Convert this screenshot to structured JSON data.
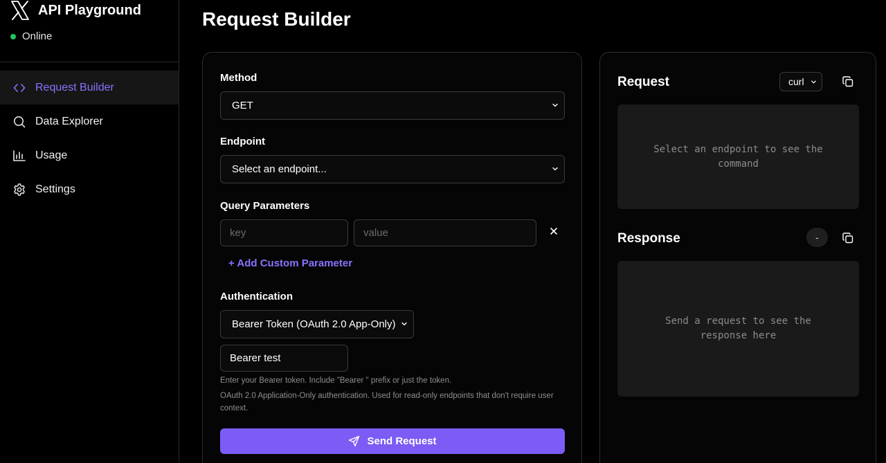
{
  "app": {
    "title": "API Playground",
    "status": "Online",
    "brand_icon": "x-logo-icon",
    "status_color": "#22c55e"
  },
  "sidebar": {
    "items": [
      {
        "label": "Request Builder",
        "icon": "code-icon",
        "active": true
      },
      {
        "label": "Data Explorer",
        "icon": "search-icon",
        "active": false
      },
      {
        "label": "Usage",
        "icon": "bar-chart-icon",
        "active": false
      },
      {
        "label": "Settings",
        "icon": "gear-icon",
        "active": false
      }
    ]
  },
  "page": {
    "title": "Request Builder"
  },
  "builder": {
    "method": {
      "label": "Method",
      "value": "GET"
    },
    "endpoint": {
      "label": "Endpoint",
      "value": "Select an endpoint..."
    },
    "query": {
      "label": "Query Parameters",
      "key_placeholder": "key",
      "value_placeholder": "value",
      "add_label": "+ Add Custom Parameter"
    },
    "auth": {
      "label": "Authentication",
      "type": "Bearer Token (OAuth 2.0 App-Only)",
      "token_value": "Bearer test",
      "help1": "Enter your Bearer token. Include \"Bearer \" prefix or just the token.",
      "help2": "OAuth 2.0 Application-Only authentication. Used for read-only endpoints that don't require user context."
    },
    "send_label": "Send Request"
  },
  "output": {
    "request": {
      "title": "Request",
      "lang": "curl",
      "placeholder": "Select an endpoint to see the command"
    },
    "response": {
      "title": "Response",
      "status": "-",
      "placeholder": "Send a request to see the response here"
    }
  },
  "colors": {
    "accent": "#7c5cf5",
    "accent_text": "#8b72ff",
    "background": "#000000"
  }
}
